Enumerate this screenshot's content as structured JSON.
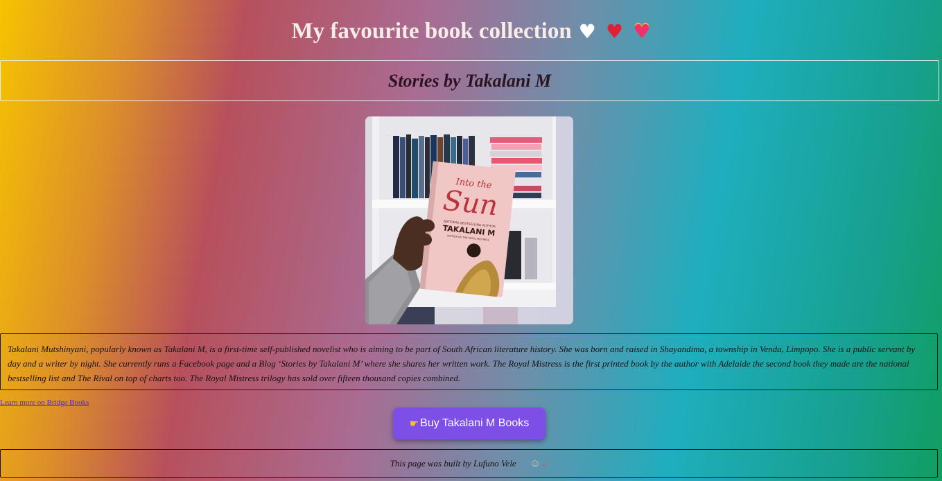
{
  "header": {
    "title": "My favourite book collection",
    "heart_icons": [
      "white-heart-icon",
      "red-heart-icon",
      "heart-on-fire-icon"
    ]
  },
  "subtitle": "Stories by Takalani M",
  "photo": {
    "book_title_line1": "Into the",
    "book_title_line2": "Sun",
    "book_tagline": "NATIONAL BESTSELLING AUTHOR",
    "book_author": "TAKALANI M",
    "book_subline": "AUTHOR OF THE ROYAL MISTRESS"
  },
  "bio": "Takalani Mutshinyani, popularly known as Takalani M, is a first-time self-published novelist who is aiming to be part of South African literature history. She was born and raised in Shayandima, a township in Venda, Limpopo. She is a public servant by day and a writer by night. She currently runs a Facebook page and a Blog ‘Stories by Takalani M’ where she shares her written work. The Royal Mistress is the first printed book by the author with Adelaide the second book they made are the national bestselling list and The Rival on top of charts too. The Royal Mistress trilogy has sold over fifteen thousand copies combined.",
  "learn_more_link": "Learn more on Bridge Books",
  "buy_button": {
    "icon": "pointing-hand-icon",
    "label": "Buy Takalani M Books"
  },
  "footer": {
    "text": "This page was built by Lufuno Vele",
    "icons": [
      "laptop-icon",
      "technologist-icon",
      "rocket-icon"
    ]
  },
  "colors": {
    "button": "#7d4fe6",
    "title_text": "#f7ece8",
    "link": "#4b2bbf"
  }
}
